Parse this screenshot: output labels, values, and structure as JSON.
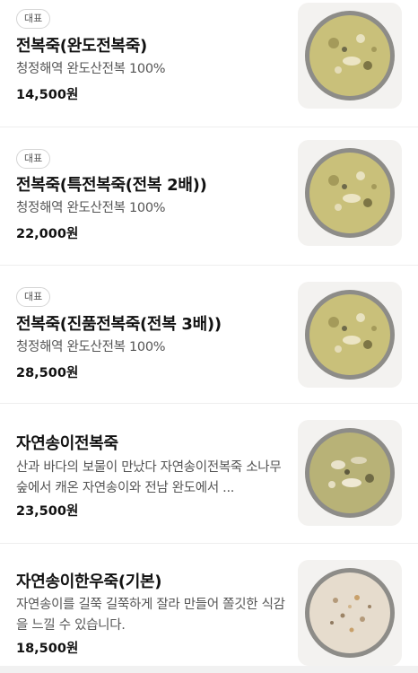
{
  "menu": {
    "items": [
      {
        "badge": "대표",
        "name": "전복죽(완도전복죽)",
        "description": "청정해역 완도산전복 100%",
        "price": "14,500원",
        "image": "abalone-porridge"
      },
      {
        "badge": "대표",
        "name": "전복죽(특전복죽(전복 2배))",
        "description": "청정해역 완도산전복 100%",
        "price": "22,000원",
        "image": "abalone-porridge"
      },
      {
        "badge": "대표",
        "name": "전복죽(진품전복죽(전복 3배))",
        "description": "청정해역 완도산전복 100%",
        "price": "28,500원",
        "image": "abalone-porridge"
      },
      {
        "name": "자연송이전복죽",
        "description": "산과 바다의 보물이 만났다 자연송이전복죽 소나무 숲에서 캐온 자연송이와 전남 완도에서 ...",
        "price": "23,500원",
        "image": "mushroom-abalone-porridge"
      },
      {
        "name": "자연송이한우죽(기본)",
        "description": "자연송이를 길쭉 길쭉하게 잘라 만들어 쫄깃한 식감을 느낄 수 있습니다.",
        "price": "18,500원",
        "image": "mushroom-beef-porridge"
      }
    ]
  },
  "colors": {
    "abalone_porridge": "#c9c07a",
    "beef_porridge": "#e6dccd",
    "bowl_rim": "#8d8c88"
  }
}
